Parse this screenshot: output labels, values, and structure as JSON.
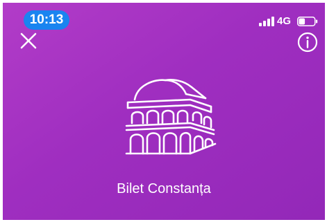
{
  "status_bar": {
    "time": "10:13",
    "network_type": "4G",
    "signal_bars": 4,
    "battery_level": 0.4
  },
  "header": {
    "close_icon": "close-icon",
    "info_icon": "info-icon"
  },
  "main": {
    "illustration_icon": "building-icon",
    "title": "Bilet Constanța"
  },
  "colors": {
    "background": "#a232c2",
    "time_pill": "#1a84f0",
    "foreground": "#ffffff"
  }
}
